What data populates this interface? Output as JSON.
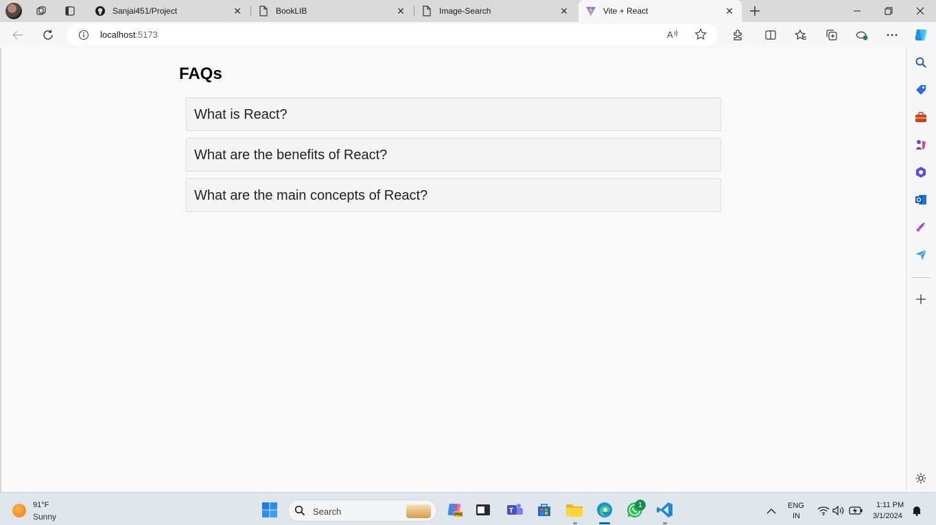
{
  "browser": {
    "tabs": [
      {
        "title": "Sanjai451/Project",
        "icon": "github-icon"
      },
      {
        "title": "BookLIB",
        "icon": "page-icon"
      },
      {
        "title": "Image-Search",
        "icon": "page-icon"
      },
      {
        "title": "Vite + React",
        "icon": "vite-icon",
        "active": true
      }
    ],
    "address": {
      "host": "localhost",
      "port": ":5173"
    }
  },
  "page": {
    "title": "FAQs",
    "faqs": [
      {
        "question": "What is React?"
      },
      {
        "question": "What are the benefits of React?"
      },
      {
        "question": "What are the main concepts of React?"
      }
    ]
  },
  "taskbar": {
    "weather": {
      "temp": "91°F",
      "condition": "Sunny"
    },
    "search_label": "Search",
    "whatsapp_badge": "1",
    "language": {
      "line1": "ENG",
      "line2": "IN"
    },
    "clock": {
      "time": "1:11 PM",
      "date": "3/1/2024"
    }
  },
  "colors": {
    "accent": "#0067c0",
    "page_bg": "#f9f9f9",
    "faq_border": "#dcdcdc"
  }
}
